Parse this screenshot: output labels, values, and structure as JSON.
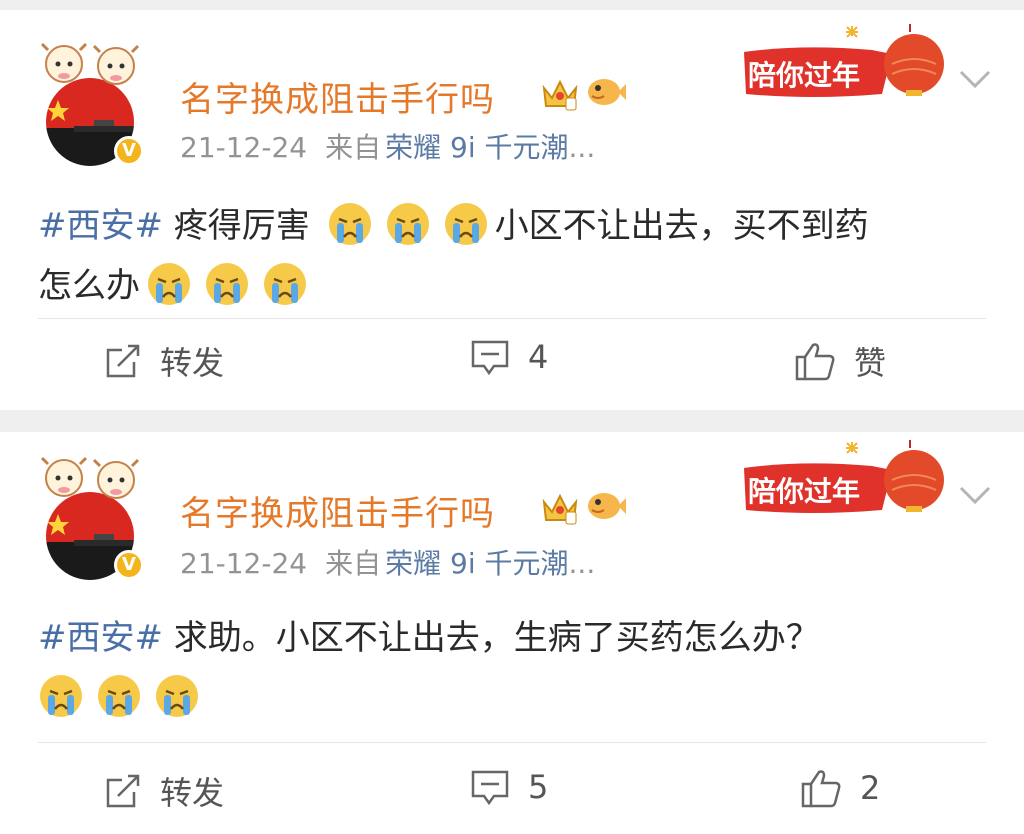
{
  "posts": [
    {
      "user": {
        "name": "名字换成阻击手行吗",
        "verified_mark": "V"
      },
      "festival_badge": "陪你过年",
      "meta": {
        "date": "21-12-24",
        "source_prefix": "来自",
        "device": "荣耀 9i 千元潮",
        "ellipsis": "..."
      },
      "text": {
        "topic": "#西安#",
        "line1": "疼得厉害",
        "line1b": "小区不让出去，买不到药",
        "line2": "怎么办"
      },
      "actions": {
        "repost_label": "转发",
        "comment_count": "4",
        "like_label": "赞"
      }
    },
    {
      "user": {
        "name": "名字换成阻击手行吗",
        "verified_mark": "V"
      },
      "festival_badge": "陪你过年",
      "meta": {
        "date": "21-12-24",
        "source_prefix": "来自",
        "device": "荣耀 9i 千元潮",
        "ellipsis": "..."
      },
      "text": {
        "topic": "#西安#",
        "line1": "求助。小区不让出去，生病了买药怎么办？"
      },
      "actions": {
        "repost_label": "转发",
        "comment_count": "5",
        "like_count": "2"
      }
    }
  ],
  "colors": {
    "username": "#e5792a",
    "topic": "#4a6fa6",
    "device": "#5b7ba4",
    "badge_red": "#e0322b"
  }
}
